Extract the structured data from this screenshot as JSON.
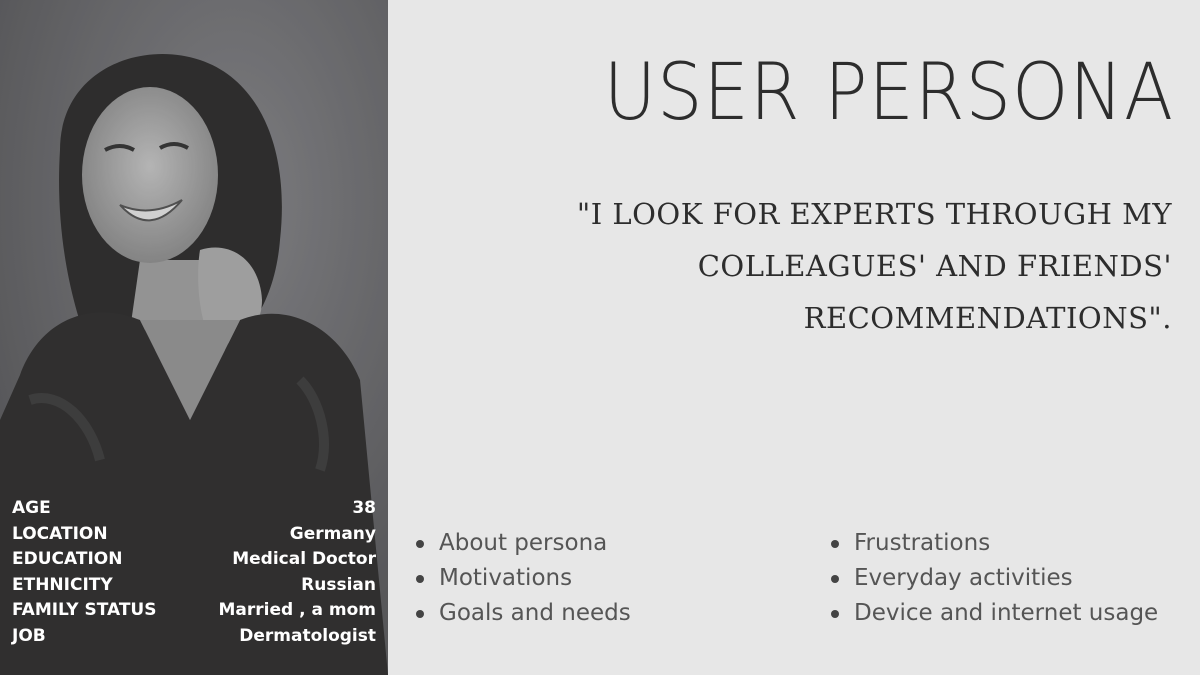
{
  "title": "USER PERSONA",
  "quote": {
    "line1": "\"I LOOK FOR EXPERTS THROUGH MY",
    "line2": "COLLEAGUES' AND FRIENDS'",
    "line3": "RECOMMENDATIONS\"."
  },
  "stats": [
    {
      "label": "AGE",
      "value": "38"
    },
    {
      "label": "LOCATION",
      "value": "Germany"
    },
    {
      "label": "EDUCATION",
      "value": "Medical Doctor"
    },
    {
      "label": "ETHNICITY",
      "value": "Russian"
    },
    {
      "label": "FAMILY STATUS",
      "value": "Married , a mom"
    },
    {
      "label": "JOB",
      "value": "Dermatologist"
    }
  ],
  "list_left": [
    "About persona",
    "Motivations",
    "Goals and needs"
  ],
  "list_right": [
    "Frustrations",
    "Everyday activities",
    "Device and internet usage"
  ],
  "colors": {
    "background": "#e7e7e7",
    "photo_panel": "#6b6b6f",
    "text": "#2d2d2d",
    "stat_text": "#ffffff"
  }
}
